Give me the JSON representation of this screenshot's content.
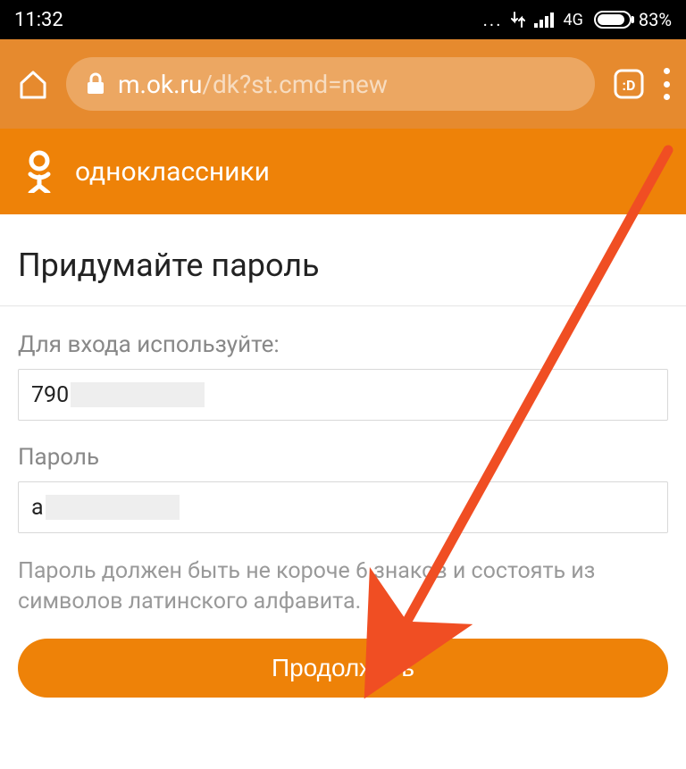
{
  "status": {
    "time": "11:32",
    "dots": "...",
    "network": "4G",
    "battery_pct": "83%"
  },
  "browser": {
    "url_host": "m.ok.ru",
    "url_path": "/dk?st.cmd=new",
    "tabs_glyph": ":D"
  },
  "site": {
    "title": "одноклассники"
  },
  "page": {
    "heading": "Придумайте пароль",
    "login_label": "Для входа используйте:",
    "login_value_visible": "790",
    "password_label": "Пароль",
    "password_value_visible": "a",
    "hint": "Пароль должен быть не короче 6 знаков и состоять из символов латинского алфавита.",
    "continue_label": "Продолжить"
  },
  "colors": {
    "browser_bar": "#e68a2e",
    "site_header": "#ee8208",
    "accent": "#ee8208"
  }
}
